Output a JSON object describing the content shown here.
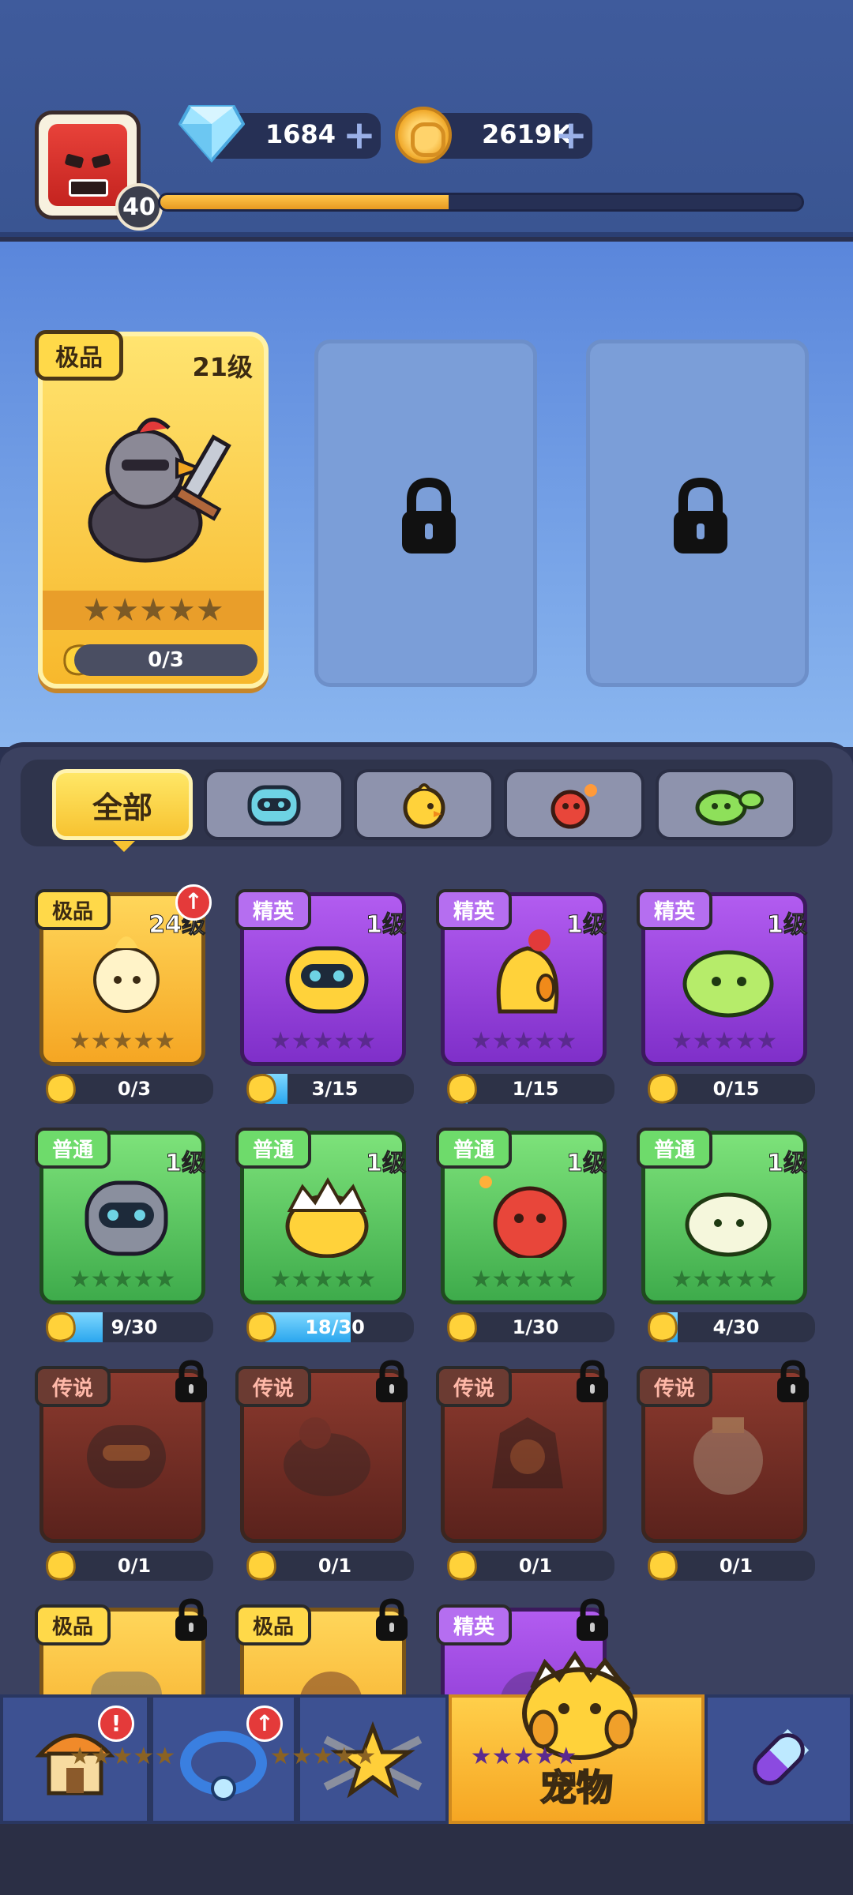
{
  "header": {
    "player_level": "40",
    "xp_progress": 0.45,
    "gems": "1684",
    "coins": "2619K"
  },
  "equipped": {
    "rarity": "极品",
    "level": "21级",
    "stars": 5,
    "progress": "0/3"
  },
  "tabs": [
    {
      "label": "全部",
      "icon": "all"
    },
    {
      "label": "",
      "icon": "robot-pet-icon"
    },
    {
      "label": "",
      "icon": "chick-pet-icon"
    },
    {
      "label": "",
      "icon": "flame-pet-icon"
    },
    {
      "label": "",
      "icon": "sprout-pet-icon"
    }
  ],
  "pets": [
    {
      "rarity": "极品",
      "level": "24级",
      "progress": "0/3",
      "fill": 0,
      "upgrade": true,
      "locked": false
    },
    {
      "rarity": "精英",
      "level": "1级",
      "progress": "3/15",
      "fill": 0.2,
      "upgrade": false,
      "locked": false
    },
    {
      "rarity": "精英",
      "level": "1级",
      "progress": "1/15",
      "fill": 0.07,
      "upgrade": false,
      "locked": false
    },
    {
      "rarity": "精英",
      "level": "1级",
      "progress": "0/15",
      "fill": 0,
      "upgrade": false,
      "locked": false
    },
    {
      "rarity": "普通",
      "level": "1级",
      "progress": "9/30",
      "fill": 0.3,
      "upgrade": false,
      "locked": false
    },
    {
      "rarity": "普通",
      "level": "1级",
      "progress": "18/30",
      "fill": 0.6,
      "upgrade": false,
      "locked": false
    },
    {
      "rarity": "普通",
      "level": "1级",
      "progress": "1/30",
      "fill": 0.03,
      "upgrade": false,
      "locked": false
    },
    {
      "rarity": "普通",
      "level": "1级",
      "progress": "4/30",
      "fill": 0.13,
      "upgrade": false,
      "locked": false
    },
    {
      "rarity": "传说",
      "level": "",
      "progress": "0/1",
      "fill": 0,
      "upgrade": false,
      "locked": true
    },
    {
      "rarity": "传说",
      "level": "",
      "progress": "0/1",
      "fill": 0,
      "upgrade": false,
      "locked": true
    },
    {
      "rarity": "传说",
      "level": "",
      "progress": "0/1",
      "fill": 0,
      "upgrade": false,
      "locked": true
    },
    {
      "rarity": "传说",
      "level": "",
      "progress": "0/1",
      "fill": 0,
      "upgrade": false,
      "locked": true
    },
    {
      "rarity": "极品",
      "level": "",
      "progress": "",
      "fill": 0,
      "upgrade": false,
      "locked": true
    },
    {
      "rarity": "极品",
      "level": "",
      "progress": "",
      "fill": 0,
      "upgrade": false,
      "locked": true
    },
    {
      "rarity": "精英",
      "level": "",
      "progress": "",
      "fill": 0,
      "upgrade": false,
      "locked": true
    }
  ],
  "nav": [
    {
      "name": "shop",
      "icon": "house-icon",
      "badge": "!"
    },
    {
      "name": "gear",
      "icon": "ring-icon",
      "badge": "↑"
    },
    {
      "name": "battle",
      "icon": "star-swords-icon",
      "badge": ""
    },
    {
      "name": "pets",
      "icon": "chick-egg-icon",
      "label": "宠物",
      "active": true
    },
    {
      "name": "skills",
      "icon": "capsule-icon",
      "badge": ""
    }
  ]
}
